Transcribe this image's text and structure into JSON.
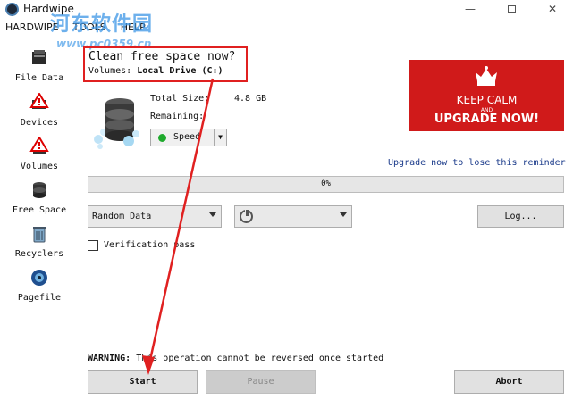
{
  "window": {
    "title": "Hardwipe",
    "min_glyph": "—",
    "close_glyph": "✕"
  },
  "menu": [
    "HARDWIPE",
    "TOOLS",
    "HELP"
  ],
  "watermark": {
    "text": "河东软件园",
    "url": "www.pc0359.cn"
  },
  "sidebar": {
    "items": [
      {
        "label": "File Data",
        "icon": "file-data-icon"
      },
      {
        "label": "Devices",
        "icon": "devices-icon"
      },
      {
        "label": "Volumes",
        "icon": "volumes-icon"
      },
      {
        "label": "Free Space",
        "icon": "free-space-icon"
      },
      {
        "label": "Recyclers",
        "icon": "recycler-icon"
      },
      {
        "label": "Pagefile",
        "icon": "pagefile-icon"
      }
    ]
  },
  "header": {
    "title": "Clean free space now?",
    "volumes_label": "Volumes:",
    "volumes_value": "Local Drive (C:)"
  },
  "drive": {
    "total_size_label": "Total Size:",
    "total_size_value": "4.8 GB",
    "remaining_label": "Remaining:",
    "speed_value": "Speed"
  },
  "banner": {
    "line1": "KEEP CALM",
    "line2": "AND",
    "line3": "UPGRADE NOW!",
    "color": "#d01a1a"
  },
  "upgrade_link": "Upgrade now to lose this reminder",
  "progress": {
    "percent": 0,
    "label": "0%"
  },
  "controls": {
    "method_value": "Random Data",
    "power_select_value": "",
    "log_button": "Log...",
    "verification_label": "Verification pass",
    "verification_checked": false
  },
  "warning": {
    "prefix": "WARNING:",
    "text": "This operation cannot be reversed once started"
  },
  "buttons": {
    "start": "Start",
    "pause": "Pause",
    "abort": "Abort"
  },
  "colors": {
    "accent_red": "#e02020",
    "progress_green": "#06b025",
    "link_blue": "#1a3a8a"
  }
}
